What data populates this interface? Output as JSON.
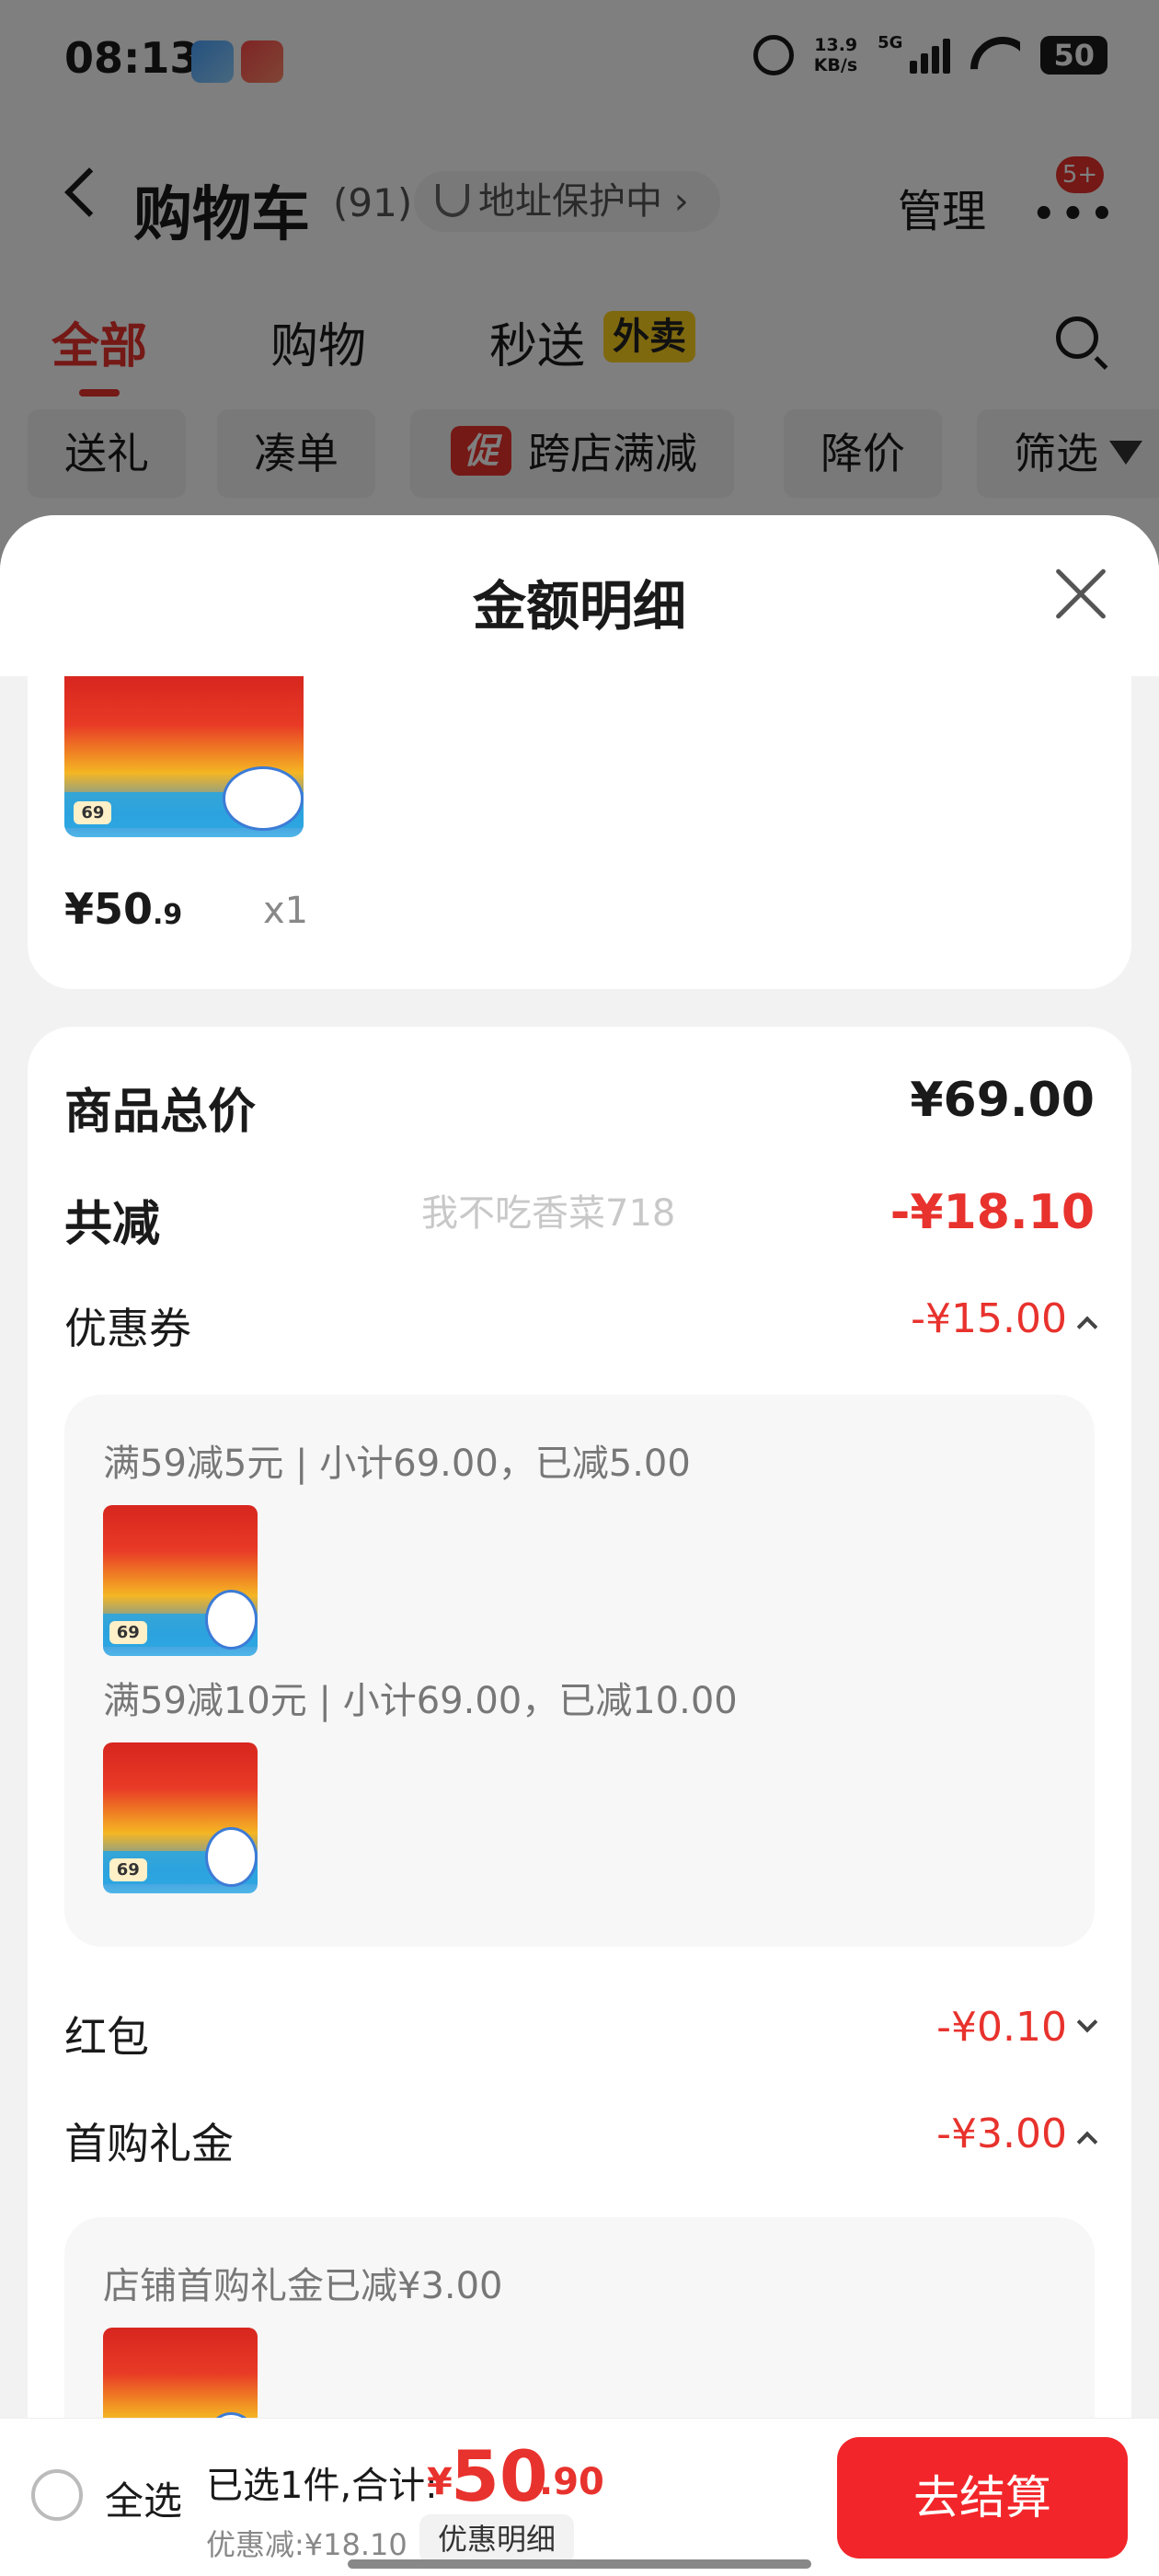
{
  "status_bar": {
    "time": "08:13",
    "net_speed_value": "13.9",
    "net_speed_unit": "KB/s",
    "network": "5G",
    "battery": "50"
  },
  "nav": {
    "title": "购物车",
    "count": "(91)",
    "address_protection": "地址保护中",
    "manage": "管理",
    "more_badge": "5+"
  },
  "tabs": [
    {
      "label": "全部",
      "active": true
    },
    {
      "label": "购物",
      "active": false
    },
    {
      "label": "秒送",
      "active": false
    }
  ],
  "tab_badge": "外卖",
  "chips": [
    "送礼",
    "凑单",
    "跨店满减",
    "降价",
    "筛选"
  ],
  "promo_tag": "促",
  "sheet": {
    "title": "金额明细"
  },
  "item": {
    "thumb_label": "69",
    "price_int": "¥50",
    "price_dec": ".9",
    "qty": "x1"
  },
  "breakdown": {
    "total_label": "商品总价",
    "total_value": "¥69.00",
    "reduction_label": "共减",
    "reduction_value": "-¥18.10",
    "watermark": "我不吃香菜718",
    "coupon_label": "优惠券",
    "coupon_value": "-¥15.00",
    "coupon_details": [
      "满59减5元 | 小计69.00，已减5.00",
      "满59减10元 | 小计69.00，已减10.00"
    ],
    "redpacket_label": "红包",
    "redpacket_value": "-¥0.10",
    "gift_label": "首购礼金",
    "gift_value": "-¥3.00",
    "gift_detail": "店铺首购礼金已减¥3.00"
  },
  "bottom_bar": {
    "select_all": "全选",
    "selected_text": "已选1件,合计:",
    "total_yen": "¥",
    "total_int": "50",
    "total_dec": ".90",
    "discount_text": "优惠减:¥18.10",
    "detail_button": "优惠明细",
    "checkout": "去结算"
  },
  "colors": {
    "accent_red": "#e8322d",
    "checkout_red": "#f2262a",
    "badge_yellow": "#ffd21f"
  }
}
